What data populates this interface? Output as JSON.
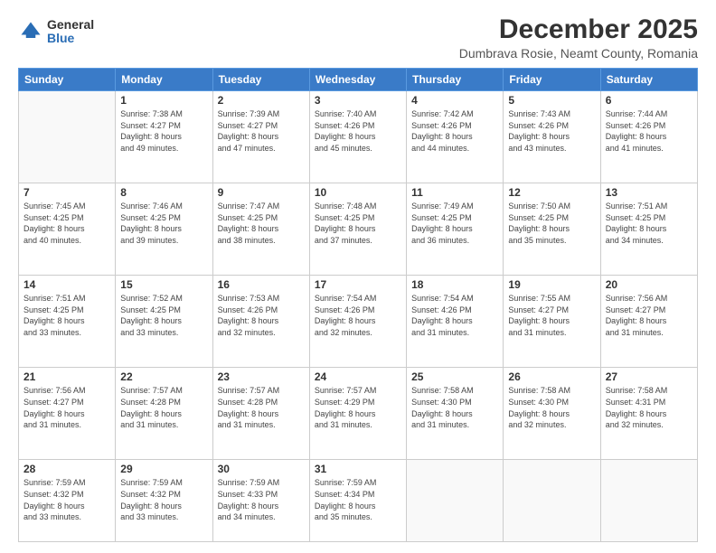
{
  "logo": {
    "general": "General",
    "blue": "Blue"
  },
  "header": {
    "month": "December 2025",
    "location": "Dumbrava Rosie, Neamt County, Romania"
  },
  "days_of_week": [
    "Sunday",
    "Monday",
    "Tuesday",
    "Wednesday",
    "Thursday",
    "Friday",
    "Saturday"
  ],
  "weeks": [
    [
      {
        "day": "",
        "info": ""
      },
      {
        "day": "1",
        "info": "Sunrise: 7:38 AM\nSunset: 4:27 PM\nDaylight: 8 hours\nand 49 minutes."
      },
      {
        "day": "2",
        "info": "Sunrise: 7:39 AM\nSunset: 4:27 PM\nDaylight: 8 hours\nand 47 minutes."
      },
      {
        "day": "3",
        "info": "Sunrise: 7:40 AM\nSunset: 4:26 PM\nDaylight: 8 hours\nand 45 minutes."
      },
      {
        "day": "4",
        "info": "Sunrise: 7:42 AM\nSunset: 4:26 PM\nDaylight: 8 hours\nand 44 minutes."
      },
      {
        "day": "5",
        "info": "Sunrise: 7:43 AM\nSunset: 4:26 PM\nDaylight: 8 hours\nand 43 minutes."
      },
      {
        "day": "6",
        "info": "Sunrise: 7:44 AM\nSunset: 4:26 PM\nDaylight: 8 hours\nand 41 minutes."
      }
    ],
    [
      {
        "day": "7",
        "info": "Sunrise: 7:45 AM\nSunset: 4:25 PM\nDaylight: 8 hours\nand 40 minutes."
      },
      {
        "day": "8",
        "info": "Sunrise: 7:46 AM\nSunset: 4:25 PM\nDaylight: 8 hours\nand 39 minutes."
      },
      {
        "day": "9",
        "info": "Sunrise: 7:47 AM\nSunset: 4:25 PM\nDaylight: 8 hours\nand 38 minutes."
      },
      {
        "day": "10",
        "info": "Sunrise: 7:48 AM\nSunset: 4:25 PM\nDaylight: 8 hours\nand 37 minutes."
      },
      {
        "day": "11",
        "info": "Sunrise: 7:49 AM\nSunset: 4:25 PM\nDaylight: 8 hours\nand 36 minutes."
      },
      {
        "day": "12",
        "info": "Sunrise: 7:50 AM\nSunset: 4:25 PM\nDaylight: 8 hours\nand 35 minutes."
      },
      {
        "day": "13",
        "info": "Sunrise: 7:51 AM\nSunset: 4:25 PM\nDaylight: 8 hours\nand 34 minutes."
      }
    ],
    [
      {
        "day": "14",
        "info": "Sunrise: 7:51 AM\nSunset: 4:25 PM\nDaylight: 8 hours\nand 33 minutes."
      },
      {
        "day": "15",
        "info": "Sunrise: 7:52 AM\nSunset: 4:25 PM\nDaylight: 8 hours\nand 33 minutes."
      },
      {
        "day": "16",
        "info": "Sunrise: 7:53 AM\nSunset: 4:26 PM\nDaylight: 8 hours\nand 32 minutes."
      },
      {
        "day": "17",
        "info": "Sunrise: 7:54 AM\nSunset: 4:26 PM\nDaylight: 8 hours\nand 32 minutes."
      },
      {
        "day": "18",
        "info": "Sunrise: 7:54 AM\nSunset: 4:26 PM\nDaylight: 8 hours\nand 31 minutes."
      },
      {
        "day": "19",
        "info": "Sunrise: 7:55 AM\nSunset: 4:27 PM\nDaylight: 8 hours\nand 31 minutes."
      },
      {
        "day": "20",
        "info": "Sunrise: 7:56 AM\nSunset: 4:27 PM\nDaylight: 8 hours\nand 31 minutes."
      }
    ],
    [
      {
        "day": "21",
        "info": "Sunrise: 7:56 AM\nSunset: 4:27 PM\nDaylight: 8 hours\nand 31 minutes."
      },
      {
        "day": "22",
        "info": "Sunrise: 7:57 AM\nSunset: 4:28 PM\nDaylight: 8 hours\nand 31 minutes."
      },
      {
        "day": "23",
        "info": "Sunrise: 7:57 AM\nSunset: 4:28 PM\nDaylight: 8 hours\nand 31 minutes."
      },
      {
        "day": "24",
        "info": "Sunrise: 7:57 AM\nSunset: 4:29 PM\nDaylight: 8 hours\nand 31 minutes."
      },
      {
        "day": "25",
        "info": "Sunrise: 7:58 AM\nSunset: 4:30 PM\nDaylight: 8 hours\nand 31 minutes."
      },
      {
        "day": "26",
        "info": "Sunrise: 7:58 AM\nSunset: 4:30 PM\nDaylight: 8 hours\nand 32 minutes."
      },
      {
        "day": "27",
        "info": "Sunrise: 7:58 AM\nSunset: 4:31 PM\nDaylight: 8 hours\nand 32 minutes."
      }
    ],
    [
      {
        "day": "28",
        "info": "Sunrise: 7:59 AM\nSunset: 4:32 PM\nDaylight: 8 hours\nand 33 minutes."
      },
      {
        "day": "29",
        "info": "Sunrise: 7:59 AM\nSunset: 4:32 PM\nDaylight: 8 hours\nand 33 minutes."
      },
      {
        "day": "30",
        "info": "Sunrise: 7:59 AM\nSunset: 4:33 PM\nDaylight: 8 hours\nand 34 minutes."
      },
      {
        "day": "31",
        "info": "Sunrise: 7:59 AM\nSunset: 4:34 PM\nDaylight: 8 hours\nand 35 minutes."
      },
      {
        "day": "",
        "info": ""
      },
      {
        "day": "",
        "info": ""
      },
      {
        "day": "",
        "info": ""
      }
    ]
  ]
}
